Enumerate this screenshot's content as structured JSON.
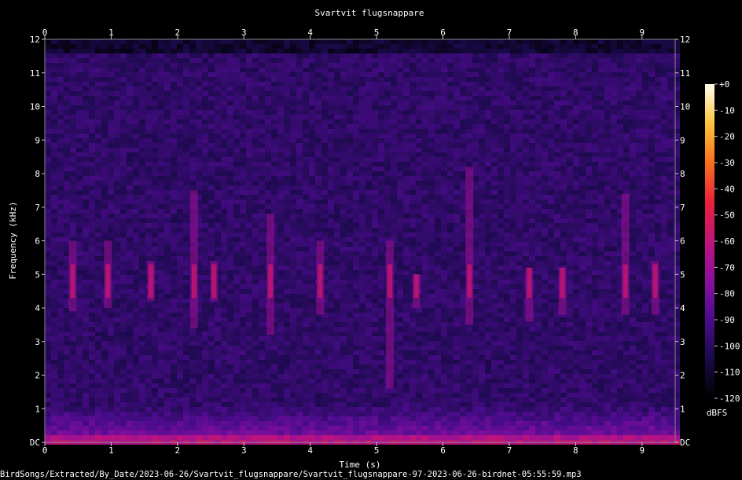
{
  "chart_data": {
    "type": "heatmap",
    "title": "Svartvit flugsnappare",
    "xlabel": "Time (s)",
    "ylabel": "Frequency (kHz)",
    "x_ticks": [
      "0",
      "1",
      "2",
      "3",
      "4",
      "5",
      "6",
      "7",
      "8",
      "9"
    ],
    "xlim": [
      0,
      9.5
    ],
    "y_ticks": [
      "DC",
      "1",
      "2",
      "3",
      "4",
      "5",
      "6",
      "7",
      "8",
      "9",
      "10",
      "11",
      "12"
    ],
    "ylim": [
      0,
      12
    ],
    "colorbar": {
      "label": "dBFS",
      "ticks": [
        "+0",
        "-10",
        "-20",
        "-30",
        "-40",
        "-50",
        "-60",
        "-70",
        "-80",
        "-90",
        "-100",
        "-110",
        "-120"
      ],
      "range": [
        -120,
        0
      ],
      "colors": [
        "#000000",
        "#1a0a4a",
        "#4b0c8c",
        "#8a0fa0",
        "#c0147a",
        "#e8203a",
        "#f8701c",
        "#fcc43a",
        "#fffff0"
      ]
    },
    "calls": [
      {
        "t": 0.42,
        "f_lo": 3.9,
        "f_hi": 6.0
      },
      {
        "t": 0.95,
        "f_lo": 4.0,
        "f_hi": 6.0
      },
      {
        "t": 1.6,
        "f_lo": 4.2,
        "f_hi": 5.4
      },
      {
        "t": 2.25,
        "f_lo": 3.4,
        "f_hi": 7.5
      },
      {
        "t": 2.55,
        "f_lo": 4.2,
        "f_hi": 5.4
      },
      {
        "t": 3.4,
        "f_lo": 3.2,
        "f_hi": 6.8
      },
      {
        "t": 4.15,
        "f_lo": 3.8,
        "f_hi": 6.0
      },
      {
        "t": 5.2,
        "f_lo": 1.6,
        "f_hi": 6.0
      },
      {
        "t": 5.6,
        "f_lo": 4.0,
        "f_hi": 5.0
      },
      {
        "t": 6.4,
        "f_lo": 3.5,
        "f_hi": 8.2
      },
      {
        "t": 7.3,
        "f_lo": 3.6,
        "f_hi": 5.2
      },
      {
        "t": 7.8,
        "f_lo": 3.8,
        "f_hi": 5.2
      },
      {
        "t": 8.75,
        "f_lo": 3.8,
        "f_hi": 7.4
      },
      {
        "t": 9.2,
        "f_lo": 3.8,
        "f_hi": 5.4
      }
    ]
  },
  "footer": {
    "file_path": "BirdSongs/Extracted/By_Date/2023-06-26/Svartvit_flugsnappare/Svartvit_flugsnappare-97-2023-06-26-birdnet-05:55:59.mp3"
  }
}
